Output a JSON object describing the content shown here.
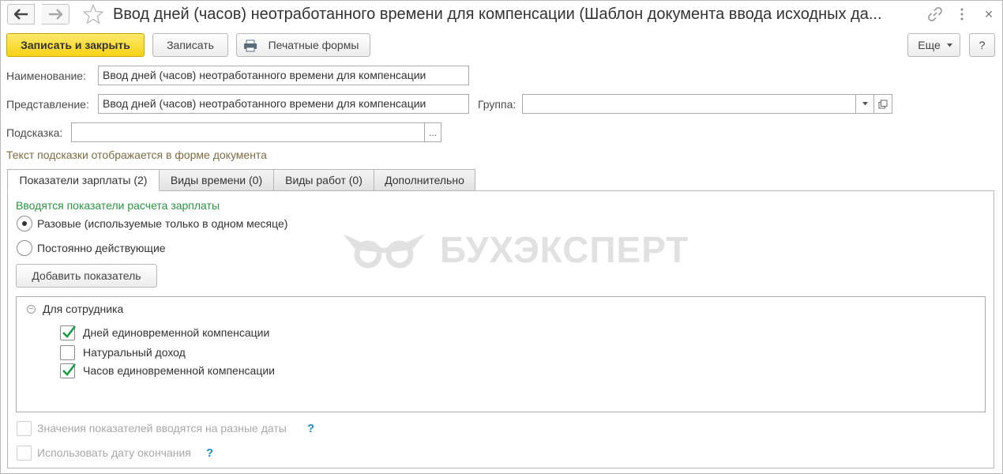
{
  "window": {
    "title": "Ввод дней (часов) неотработанного времени для компенсации (Шаблон документа ввода исходных да...",
    "nav_icons": [
      "arrow-left-icon",
      "arrow-right-icon",
      "star-icon"
    ],
    "title_icons": [
      "link-icon",
      "more-vertical-icon",
      "close-icon"
    ],
    "close_glyph": "×"
  },
  "toolbar": {
    "save_close_label": "Записать и закрыть",
    "save_label": "Записать",
    "print_label": "Печатные формы",
    "more_label": "Еще",
    "help_label": "?"
  },
  "form": {
    "name_label": "Наименование:",
    "name_value": "Ввод дней (часов) неотработанного времени для компенсации",
    "repr_label": "Представление:",
    "repr_value": "Ввод дней (часов) неотработанного времени для компенсации",
    "group_label": "Группа:",
    "group_value": "",
    "hint_label": "Подсказка:",
    "hint_value": "",
    "hint_button": "...",
    "hint_note": "Текст подсказки отображается в форме документа"
  },
  "tabs": [
    {
      "label": "Показатели зарплаты (2)",
      "active": true
    },
    {
      "label": "Виды времени (0)",
      "active": false
    },
    {
      "label": "Виды работ (0)",
      "active": false
    },
    {
      "label": "Дополнительно",
      "active": false
    }
  ],
  "panel": {
    "heading": "Вводятся показатели расчета зарплаты",
    "radio_options": [
      {
        "label": "Разовые (используемые только в одном месяце)",
        "selected": true
      },
      {
        "label": "Постоянно действующие",
        "selected": false
      }
    ],
    "add_button": "Добавить показатель",
    "watermark_text": "БУХЭКСПЕРТ",
    "tree": {
      "group_label": "Для сотрудника",
      "items": [
        {
          "label": "Дней единовременной компенсации",
          "checked": true
        },
        {
          "label": "Натуральный доход",
          "checked": false
        },
        {
          "label": "Часов единовременной компенсации",
          "checked": true
        }
      ]
    },
    "options": [
      {
        "label": "Значения показателей вводятся на разные даты",
        "checked": false,
        "enabled": false
      },
      {
        "label": "Использовать дату окончания",
        "checked": false,
        "enabled": false
      }
    ],
    "help_mark": "?"
  },
  "colors": {
    "primary_button": "#f6d217",
    "heading_green": "#2c9444",
    "check_green": "#1e9b4c",
    "hint_brown": "#7e6b45",
    "help_blue": "#1f8fbf"
  }
}
